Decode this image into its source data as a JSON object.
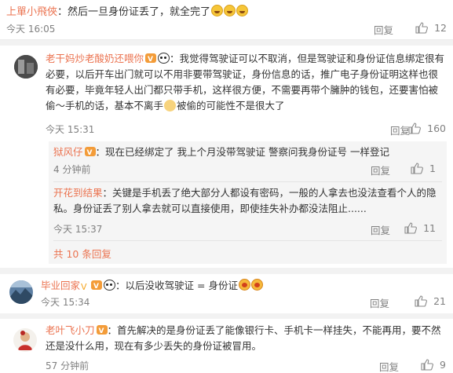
{
  "comments": [
    {
      "user": "上單小飛俠",
      "text": "然后一旦身份证丢了，就全完了",
      "time": "今天 16:05",
      "reply": "回复",
      "likes": "12"
    },
    {
      "user": "老干妈炒老酸奶还喂你",
      "text_part1": "我觉得驾驶证可以不取消，但是驾驶证和身份证信息绑定很有必要，以后开车出门就可以不用非要带驾驶证，身份信息的话，推广电子身份证明这样也很有必要，毕竟年轻人出门都只带手机，这样很方便，不需要再带个臃肿的钱包，还要害怕被偷～手机的话，基本不离手",
      "text_part2": "被偷的可能性不是很大了",
      "time": "今天 15:31",
      "reply": "回复",
      "likes": "160",
      "subreplies": [
        {
          "user": "狱风仔",
          "text": "现在已经绑定了 我上个月没带驾驶证 警察问我身份证号 一样登记",
          "time": "4 分钟前",
          "reply": "回复",
          "likes": "1"
        },
        {
          "user": "开花到结果",
          "text": "关键是手机丢了绝大部分人都设有密码，一般的人拿去也没法查看个人的隐私。身份证丢了别人拿去就可以直接使用，即使挂失补办都没法阻止......",
          "time": "今天 15:37",
          "reply": "回复",
          "likes": "11"
        }
      ],
      "more": "共 10 条回复"
    },
    {
      "user": "毕业回家",
      "text": "以后没收驾驶证 = 身份证",
      "time": "今天 15:34",
      "reply": "回复",
      "likes": "21"
    },
    {
      "user": "老叶飞小刀",
      "text": "首先解决的是身份证丢了能像银行卡、手机卡一样挂失，不能再用，要不然还是没什么用，现在有多少丢失的身份证被冒用。",
      "time": "57 分钟前",
      "reply": "回复",
      "likes": "9"
    }
  ],
  "colors": {
    "username": "#eb7350",
    "text": "#333333",
    "meta": "#808080",
    "panel": "#f5f5f5"
  }
}
